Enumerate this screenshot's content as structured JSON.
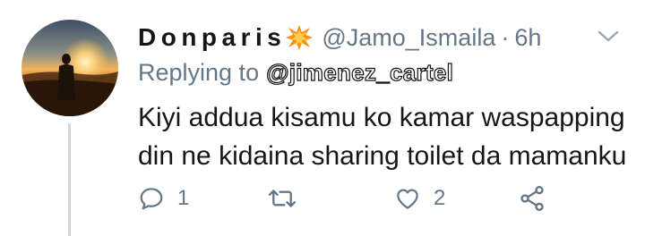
{
  "tweet": {
    "display_name": "Donparis",
    "name_emoji": "collision-icon",
    "handle": "@Jamo_Ismaila",
    "separator": "·",
    "time": "6h",
    "replying_prefix": "Replying to",
    "replying_to": "@jimenez_cartel",
    "text_lines": [
      "Kiyi addua kisamu ko kamar waspapping",
      "din ne kidaina sharing toilet da mamanku"
    ],
    "actions": {
      "reply_count": "1",
      "retweet_count": "",
      "like_count": "2"
    }
  },
  "colors": {
    "text": "#14171a",
    "secondary": "#657786",
    "thread_line": "#ccd6dd",
    "icon": "#657786"
  }
}
